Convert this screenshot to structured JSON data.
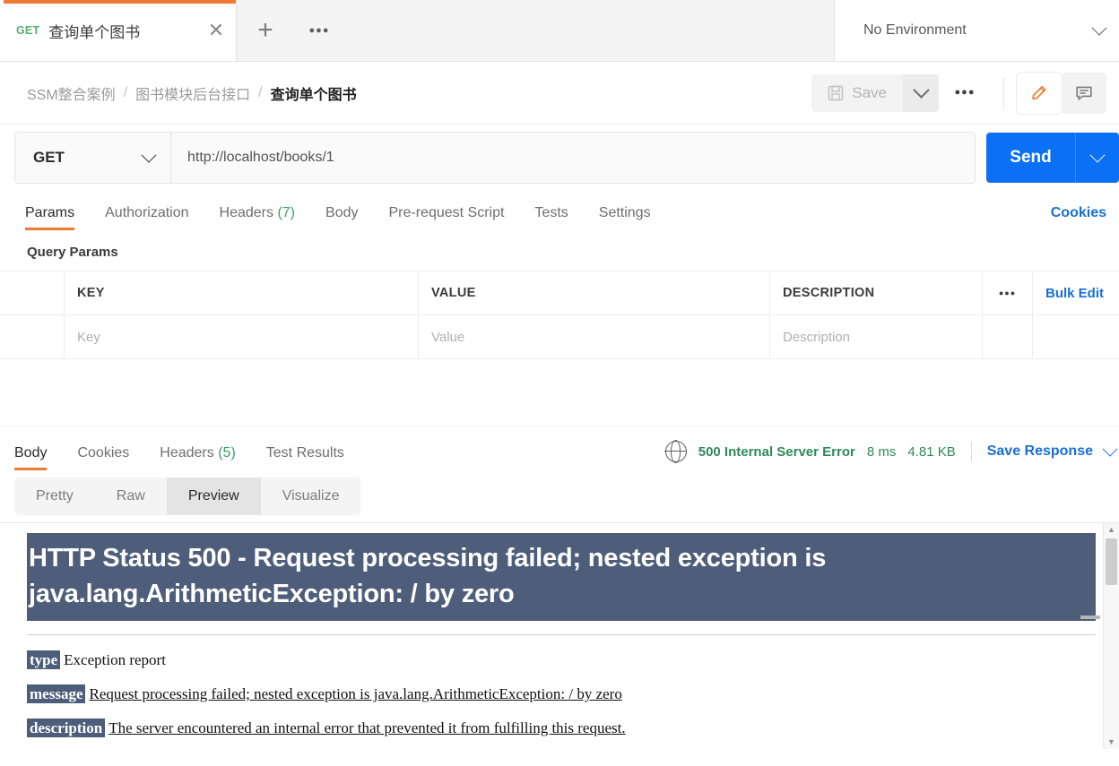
{
  "tabbar": {
    "tab": {
      "method": "GET",
      "title": "查询单个图书",
      "close_icon": "close-icon"
    },
    "new_tab_icon": "plus-icon",
    "more_icon": "ellipsis-icon",
    "environment": {
      "label": "No Environment",
      "caret_icon": "chevron-down-icon"
    }
  },
  "breadcrumb": {
    "items": [
      "SSM整合案例",
      "图书模块后台接口",
      "查询单个图书"
    ],
    "separator": "/"
  },
  "header_actions": {
    "save_label": "Save",
    "save_icon": "floppy-disk-icon",
    "save_caret_icon": "chevron-down-icon",
    "more_icon": "ellipsis-icon",
    "edit_icon": "pencil-icon",
    "comment_icon": "comment-icon"
  },
  "request": {
    "method": "GET",
    "method_caret_icon": "chevron-down-icon",
    "url": "http://localhost/books/1",
    "send_label": "Send",
    "send_caret_icon": "chevron-down-icon"
  },
  "request_tabs": {
    "items": [
      {
        "label": "Params",
        "count": "",
        "active": true
      },
      {
        "label": "Authorization",
        "count": "",
        "active": false
      },
      {
        "label": "Headers",
        "count": "(7)",
        "active": false
      },
      {
        "label": "Body",
        "count": "",
        "active": false
      },
      {
        "label": "Pre-request Script",
        "count": "",
        "active": false
      },
      {
        "label": "Tests",
        "count": "",
        "active": false
      },
      {
        "label": "Settings",
        "count": "",
        "active": false
      }
    ],
    "cookies_link": "Cookies"
  },
  "query_params": {
    "section_title": "Query Params",
    "columns": [
      "KEY",
      "VALUE",
      "DESCRIPTION"
    ],
    "more_icon": "ellipsis-icon",
    "bulk_edit_label": "Bulk Edit",
    "row_placeholders": {
      "key": "Key",
      "value": "Value",
      "description": "Description"
    }
  },
  "response_tabs": {
    "items": [
      {
        "label": "Body",
        "count": "",
        "active": true
      },
      {
        "label": "Cookies",
        "count": "",
        "active": false
      },
      {
        "label": "Headers",
        "count": "(5)",
        "active": false
      },
      {
        "label": "Test Results",
        "count": "",
        "active": false
      }
    ]
  },
  "response_meta": {
    "globe_icon": "globe-icon",
    "status": "500 Internal Server Error",
    "time": "8 ms",
    "size": "4.81 KB",
    "save_response_label": "Save Response",
    "save_response_caret_icon": "chevron-down-icon",
    "status_color": "#2f8a5b"
  },
  "view_switch": {
    "items": [
      {
        "label": "Pretty",
        "active": false
      },
      {
        "label": "Raw",
        "active": false
      },
      {
        "label": "Preview",
        "active": true
      },
      {
        "label": "Visualize",
        "active": false
      }
    ]
  },
  "error_page": {
    "banner": "HTTP Status 500 - Request processing failed; nested exception is java.lang.ArithmeticException: / by zero",
    "banner_bg": "#4d5d7a",
    "rows": [
      {
        "tag": "type",
        "text": "Exception report",
        "underline": false
      },
      {
        "tag": "message",
        "text": "Request processing failed; nested exception is java.lang.ArithmeticException: / by zero",
        "underline": true
      },
      {
        "tag": "description",
        "text": "The server encountered an internal error that prevented it from fulfilling this request.",
        "underline": true
      }
    ]
  },
  "scrollbar": {
    "up_arrow": "▲",
    "down_arrow": "▼"
  }
}
